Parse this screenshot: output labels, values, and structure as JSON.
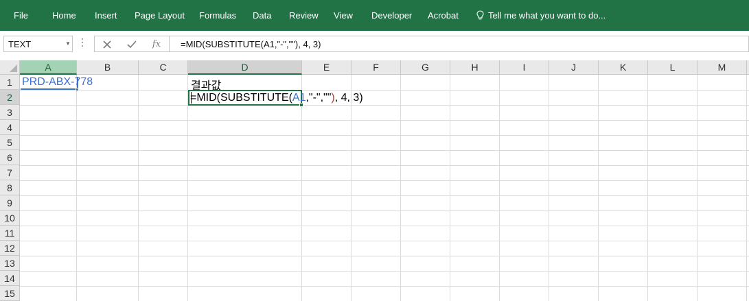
{
  "ribbon": {
    "tabs": [
      "File",
      "Home",
      "Insert",
      "Page Layout",
      "Formulas",
      "Data",
      "Review",
      "View",
      "Developer",
      "Acrobat"
    ],
    "tell_me": "Tell me what you want to do..."
  },
  "formula_bar": {
    "name_box": "TEXT",
    "formula": "=MID(SUBSTITUTE(A1,\"-\",\"\"), 4, 3)"
  },
  "sheet": {
    "columns": [
      "A",
      "B",
      "C",
      "D",
      "E",
      "F",
      "G",
      "H",
      "I",
      "J",
      "K",
      "L",
      "M"
    ],
    "rows": [
      "1",
      "2",
      "3",
      "4",
      "5",
      "6",
      "7",
      "8",
      "9",
      "10",
      "11",
      "12",
      "13",
      "14",
      "15"
    ],
    "cells": {
      "A1": "PRD-ABX-778",
      "D1": "결과값",
      "D2_parts": {
        "p1": "=MID(SUBSTITUTE(",
        "p2": "A1",
        "p3": ",\"-\",\"\"",
        "p4": ")",
        "p5": ", 4, 3)"
      }
    }
  },
  "colors": {
    "ribbon": "#217346",
    "selection": "#3a73c4",
    "edit_border": "#217346"
  }
}
